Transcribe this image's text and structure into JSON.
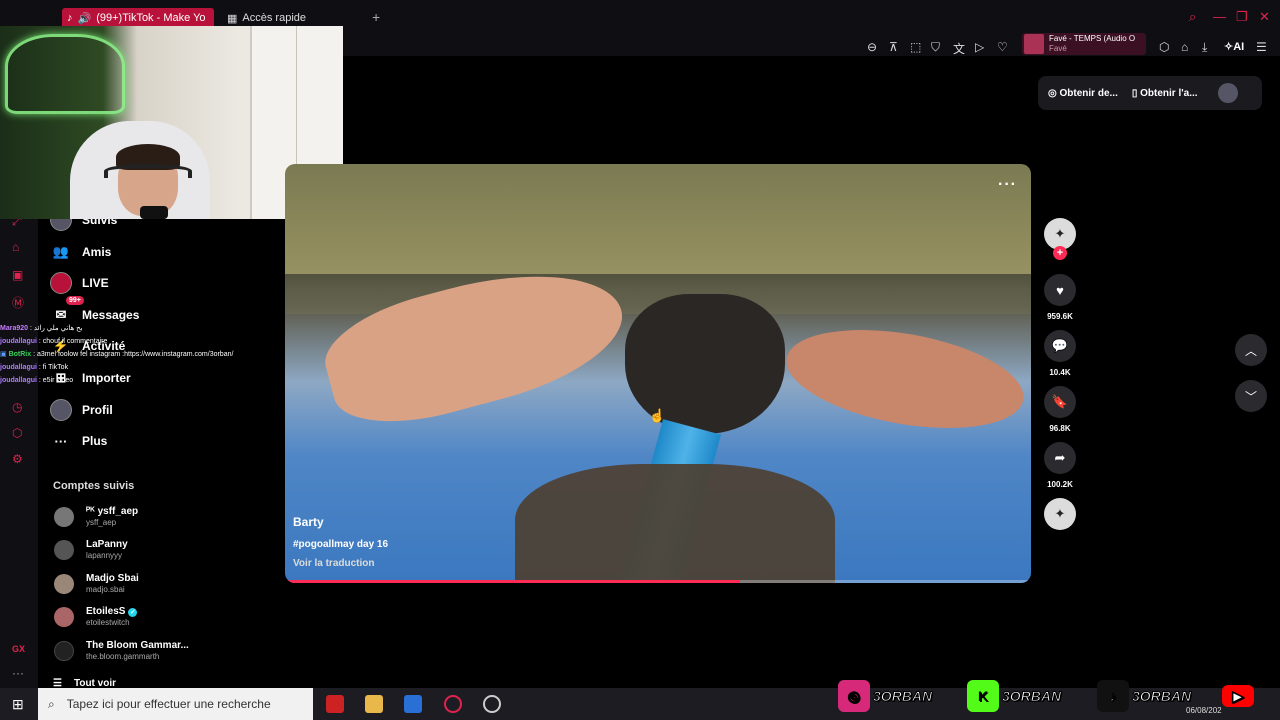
{
  "browser": {
    "active_tab": "(99+)TikTok - Make Yo",
    "tab2": "Accès rapide",
    "new_tab": "+",
    "music_title": "Favé - TEMPS (Audio O",
    "music_artist": "Favé",
    "ai_label": "AI"
  },
  "tiktok": {
    "sidebar": {
      "items": [
        {
          "label": "Suivis",
          "icon": "following-icon"
        },
        {
          "label": "Amis",
          "icon": "friends-icon"
        },
        {
          "label": "LIVE",
          "icon": "live-icon"
        },
        {
          "label": "Messages",
          "icon": "messages-icon",
          "badge": "99+"
        },
        {
          "label": "Activité",
          "icon": "activity-icon"
        },
        {
          "label": "Importer",
          "icon": "upload-icon"
        },
        {
          "label": "Profil",
          "icon": "profile-icon"
        },
        {
          "label": "Plus",
          "icon": "more-icon"
        }
      ],
      "following_title": "Comptes suivis",
      "accounts": [
        {
          "name": "ᴾᴷ ysff_aep",
          "user": "ysff_aep",
          "verified": false
        },
        {
          "name": "LaPanny",
          "user": "lapannyyy",
          "verified": false
        },
        {
          "name": "Madjo Sbai",
          "user": "madjo.sbai",
          "verified": false
        },
        {
          "name": "EtoilesS",
          "user": "etoilestwitch",
          "verified": true
        },
        {
          "name": "The Bloom Gammar...",
          "user": "the.bloom.gammarth",
          "verified": false
        }
      ],
      "see_all": "Tout voir"
    },
    "top_buttons": {
      "coins": "Obtenir de...",
      "app": "Obtenir l'a..."
    },
    "video": {
      "author": "Barty",
      "description": "#pogoallmay day 16",
      "translate": "Voir la traduction",
      "progress": 0.61
    },
    "actions": {
      "likes": "959.6K",
      "comments": "10.4K",
      "saves": "96.8K",
      "shares": "100.2K"
    }
  },
  "chat": [
    {
      "user": "Mara920",
      "msg": " : بح هاتي ملي رائد",
      "color": "#c77dff"
    },
    {
      "user": "joudallagui",
      "msg": " : chouf il commentaire",
      "color": "#b07cff"
    },
    {
      "user": "BotRix",
      "msg": " : a3mel foolow fel instagram :https://www.instagram.com/3orban/",
      "color": "#36d15a"
    },
    {
      "user": "joudallagui",
      "msg": " : fi TikTok",
      "color": "#b07cff"
    },
    {
      "user": "joudallagui",
      "msg": " : e5ir video",
      "color": "#b07cff"
    }
  ],
  "taskbar": {
    "search_placeholder": "Tapez ici pour effectuer une recherche",
    "date": "06/08/202"
  },
  "socials": [
    {
      "platform": "instagram",
      "handle": "3ORBAN",
      "color": "#d6297a"
    },
    {
      "platform": "kick",
      "handle": "3ORBAN",
      "color": "#53fc18"
    },
    {
      "platform": "tiktok",
      "handle": "3ORBAN",
      "color": "#111111"
    },
    {
      "platform": "youtube",
      "handle": "",
      "color": "#ff0000"
    }
  ]
}
